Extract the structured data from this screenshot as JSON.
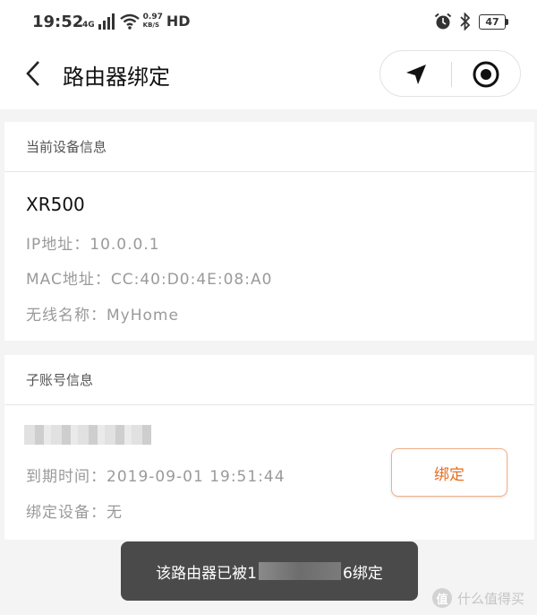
{
  "status_bar": {
    "time": "19:52",
    "network": "4G",
    "speed_value": "0.97",
    "speed_unit": "KB/S",
    "hd": "HD",
    "battery": "47"
  },
  "nav": {
    "title": "路由器绑定"
  },
  "current_device": {
    "header": "当前设备信息",
    "name": "XR500",
    "ip": "IP地址：10.0.0.1",
    "mac": "MAC地址：CC:40:D0:4E:08:A0",
    "ssid": "无线名称：MyHome"
  },
  "sub_account": {
    "header": "子账号信息",
    "expire": "到期时间：2019-09-01 19:51:44",
    "bound_device": "绑定设备：无",
    "bind_label": "绑定"
  },
  "toast": {
    "prefix": "该路由器已被1",
    "suffix": "6绑定"
  },
  "watermark": {
    "logo": "值",
    "text": "什么值得买"
  },
  "colors": {
    "accent": "#e86c1f",
    "accent_border": "#f0b089",
    "toast_bg": "#4a4a4a"
  }
}
